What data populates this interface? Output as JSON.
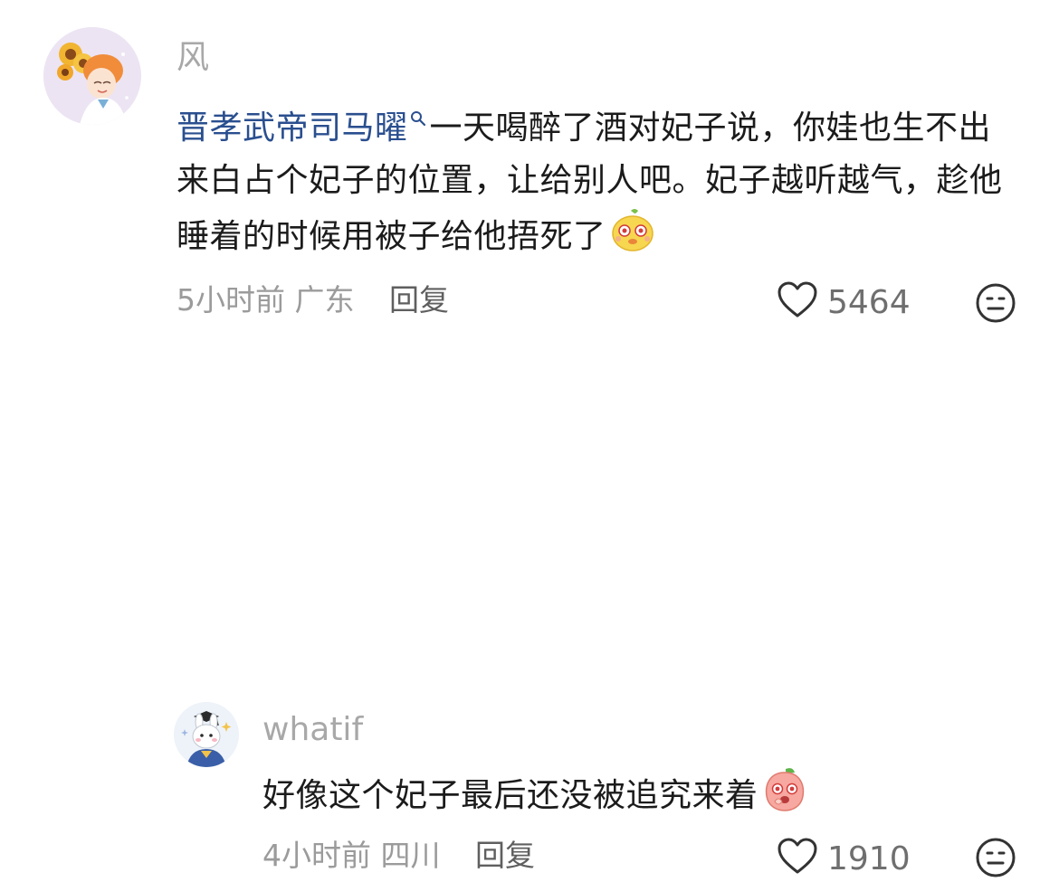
{
  "comments": [
    {
      "username": "风",
      "mention": "晋孝武帝司马曜",
      "text": "一天喝醉了酒对妃子说，你娃也生不出来白占个妃子的位置，让给别人吧。妃子越听越气，趁他睡着的时候用被子给他捂死了",
      "emoji_icon": "dizzy-chick-emoji-icon",
      "time": "5小时前",
      "location": "广东",
      "reply_label": "回复",
      "likes": "5464"
    },
    {
      "username": "whatif",
      "text": "好像这个妃子最后还没被追究来着",
      "emoji_icon": "shocked-peach-emoji-icon",
      "time": "4小时前",
      "location": "四川",
      "reply_label": "回复",
      "likes": "1910"
    }
  ],
  "icons": {
    "like": "heart-outline-icon",
    "more": "neutral-face-icon",
    "mention": "search-icon"
  },
  "colors": {
    "link": "#2a4f8f",
    "muted": "#a8a8a8",
    "text": "#1b1b1b"
  }
}
